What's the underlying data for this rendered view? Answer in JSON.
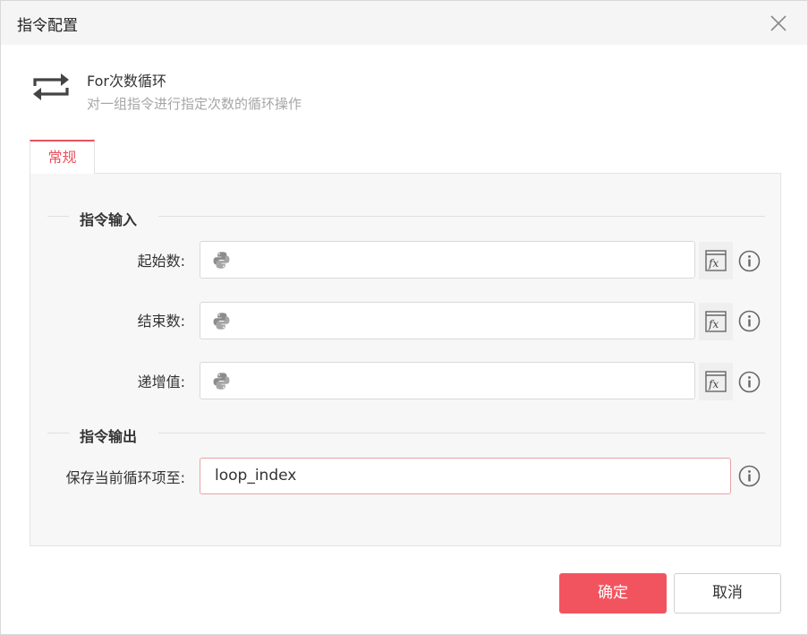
{
  "dialog": {
    "title": "指令配置"
  },
  "command": {
    "name": "For次数循环",
    "description": "对一组指令进行指定次数的循环操作",
    "icon": "loop-arrows-icon"
  },
  "tabs": [
    {
      "label": "常规",
      "active": true
    }
  ],
  "inputs_section": {
    "title": "指令输入",
    "fields": [
      {
        "label": "起始数:",
        "value": "",
        "icon": "python-icon",
        "fx_icon": "fx-icon",
        "info_icon": "info-icon"
      },
      {
        "label": "结束数:",
        "value": "",
        "icon": "python-icon",
        "fx_icon": "fx-icon",
        "info_icon": "info-icon"
      },
      {
        "label": "递增值:",
        "value": "",
        "icon": "python-icon",
        "fx_icon": "fx-icon",
        "info_icon": "info-icon"
      }
    ]
  },
  "outputs_section": {
    "title": "指令输出",
    "fields": [
      {
        "label": "保存当前循环项至:",
        "value": "loop_index",
        "info_icon": "info-icon"
      }
    ]
  },
  "buttons": {
    "ok": "确定",
    "cancel": "取消"
  },
  "colors": {
    "accent": "#f2545f",
    "tab_accent": "#e8525e",
    "panel_bg": "#f7f7f7",
    "muted_text": "#a6a6a6"
  }
}
